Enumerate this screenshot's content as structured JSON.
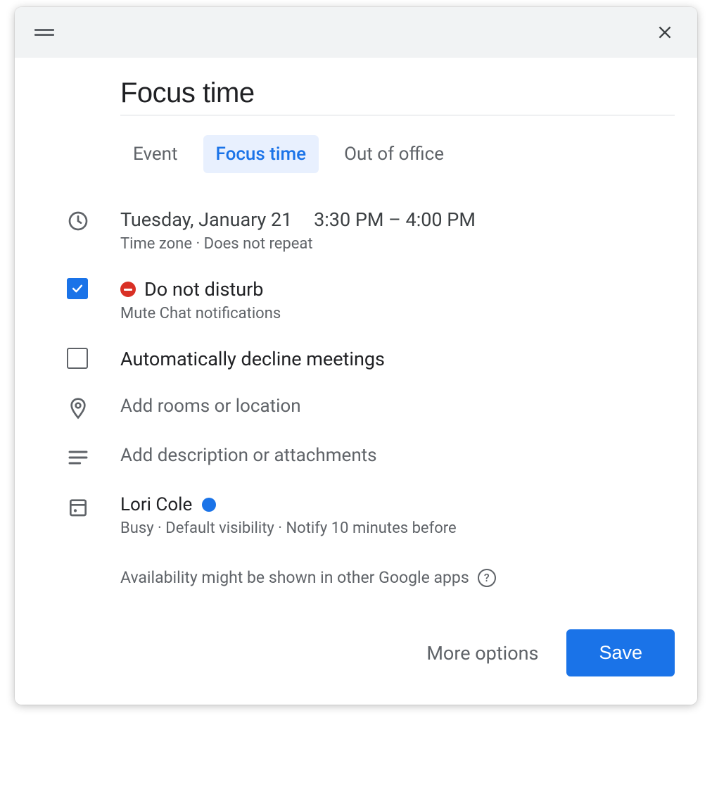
{
  "title": "Focus time",
  "tabs": [
    {
      "label": "Event",
      "active": false
    },
    {
      "label": "Focus time",
      "active": true
    },
    {
      "label": "Out of office",
      "active": false
    }
  ],
  "datetime": {
    "date": "Tuesday, January 21",
    "time": "3:30 PM – 4:00 PM",
    "sub": "Time zone · Does not repeat"
  },
  "dnd": {
    "checked": true,
    "label": "Do not disturb",
    "sub": "Mute Chat notifications"
  },
  "auto_decline": {
    "checked": false,
    "label": "Automatically decline meetings"
  },
  "location": {
    "placeholder": "Add rooms or location"
  },
  "description": {
    "placeholder": "Add description or attachments"
  },
  "calendar": {
    "owner": "Lori Cole",
    "sub": "Busy · Default visibility · Notify 10 minutes before"
  },
  "availability_note": "Availability might be shown in other Google apps",
  "footer": {
    "more_options": "More options",
    "save": "Save"
  }
}
